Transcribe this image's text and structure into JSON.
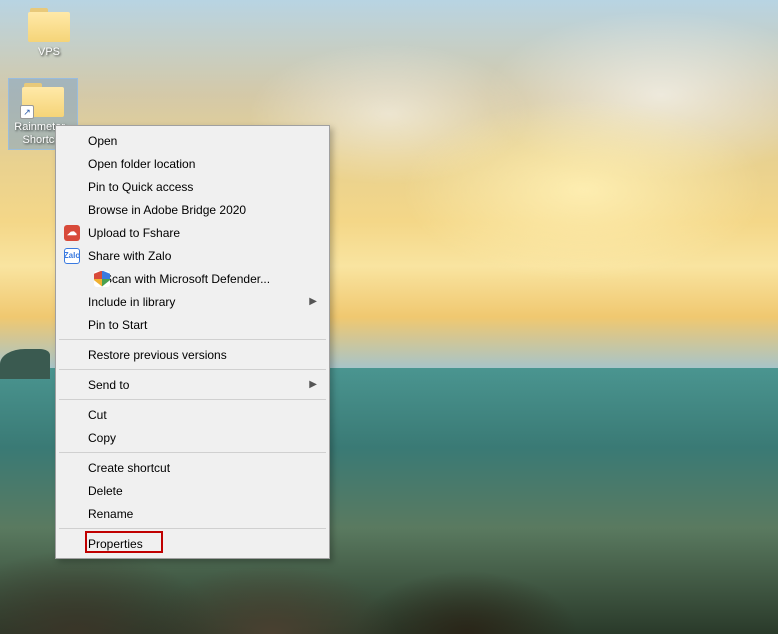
{
  "desktop": {
    "icons": [
      {
        "label": "VPS",
        "type": "folder",
        "shortcut": false,
        "selected": false
      },
      {
        "label": "Rainmeter - Shortc...",
        "type": "folder",
        "shortcut": true,
        "selected": true
      }
    ]
  },
  "context_menu": {
    "groups": [
      [
        {
          "label": "Open",
          "icon": null,
          "submenu": false
        },
        {
          "label": "Open folder location",
          "icon": null,
          "submenu": false
        },
        {
          "label": "Pin to Quick access",
          "icon": null,
          "submenu": false
        },
        {
          "label": "Browse in Adobe Bridge 2020",
          "icon": null,
          "submenu": false
        },
        {
          "label": "Upload to Fshare",
          "icon": "fshare",
          "submenu": false
        },
        {
          "label": "Share with Zalo",
          "icon": "zalo",
          "submenu": false
        },
        {
          "label": "Scan with Microsoft Defender...",
          "icon": "defender",
          "submenu": false
        },
        {
          "label": "Include in library",
          "icon": null,
          "submenu": true
        },
        {
          "label": "Pin to Start",
          "icon": null,
          "submenu": false
        }
      ],
      [
        {
          "label": "Restore previous versions",
          "icon": null,
          "submenu": false
        }
      ],
      [
        {
          "label": "Send to",
          "icon": null,
          "submenu": true
        }
      ],
      [
        {
          "label": "Cut",
          "icon": null,
          "submenu": false
        },
        {
          "label": "Copy",
          "icon": null,
          "submenu": false
        }
      ],
      [
        {
          "label": "Create shortcut",
          "icon": null,
          "submenu": false
        },
        {
          "label": "Delete",
          "icon": null,
          "submenu": false
        },
        {
          "label": "Rename",
          "icon": null,
          "submenu": false
        }
      ],
      [
        {
          "label": "Properties",
          "icon": null,
          "submenu": false,
          "highlighted": true
        }
      ]
    ]
  },
  "icons_glyph": {
    "fshare": "☁",
    "zalo": "Zalo",
    "defender": ""
  }
}
